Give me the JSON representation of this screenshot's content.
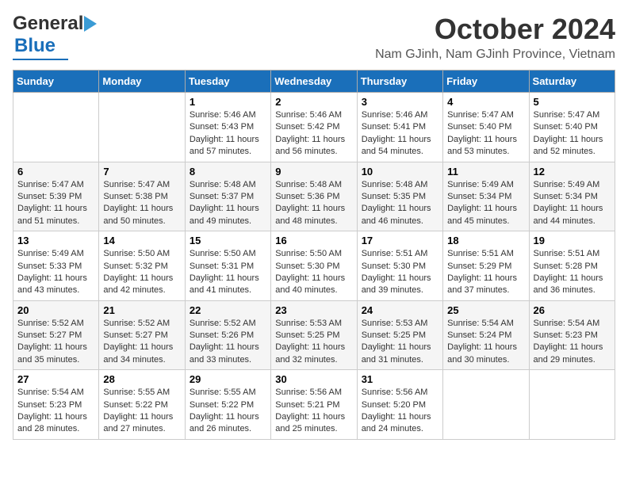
{
  "header": {
    "logo_line1": "General",
    "logo_line2": "Blue",
    "month": "October 2024",
    "location": "Nam GJinh, Nam GJinh Province, Vietnam"
  },
  "weekdays": [
    "Sunday",
    "Monday",
    "Tuesday",
    "Wednesday",
    "Thursday",
    "Friday",
    "Saturday"
  ],
  "weeks": [
    [
      {
        "day": "",
        "content": ""
      },
      {
        "day": "",
        "content": ""
      },
      {
        "day": "1",
        "content": "Sunrise: 5:46 AM\nSunset: 5:43 PM\nDaylight: 11 hours and 57 minutes."
      },
      {
        "day": "2",
        "content": "Sunrise: 5:46 AM\nSunset: 5:42 PM\nDaylight: 11 hours and 56 minutes."
      },
      {
        "day": "3",
        "content": "Sunrise: 5:46 AM\nSunset: 5:41 PM\nDaylight: 11 hours and 54 minutes."
      },
      {
        "day": "4",
        "content": "Sunrise: 5:47 AM\nSunset: 5:40 PM\nDaylight: 11 hours and 53 minutes."
      },
      {
        "day": "5",
        "content": "Sunrise: 5:47 AM\nSunset: 5:40 PM\nDaylight: 11 hours and 52 minutes."
      }
    ],
    [
      {
        "day": "6",
        "content": "Sunrise: 5:47 AM\nSunset: 5:39 PM\nDaylight: 11 hours and 51 minutes."
      },
      {
        "day": "7",
        "content": "Sunrise: 5:47 AM\nSunset: 5:38 PM\nDaylight: 11 hours and 50 minutes."
      },
      {
        "day": "8",
        "content": "Sunrise: 5:48 AM\nSunset: 5:37 PM\nDaylight: 11 hours and 49 minutes."
      },
      {
        "day": "9",
        "content": "Sunrise: 5:48 AM\nSunset: 5:36 PM\nDaylight: 11 hours and 48 minutes."
      },
      {
        "day": "10",
        "content": "Sunrise: 5:48 AM\nSunset: 5:35 PM\nDaylight: 11 hours and 46 minutes."
      },
      {
        "day": "11",
        "content": "Sunrise: 5:49 AM\nSunset: 5:34 PM\nDaylight: 11 hours and 45 minutes."
      },
      {
        "day": "12",
        "content": "Sunrise: 5:49 AM\nSunset: 5:34 PM\nDaylight: 11 hours and 44 minutes."
      }
    ],
    [
      {
        "day": "13",
        "content": "Sunrise: 5:49 AM\nSunset: 5:33 PM\nDaylight: 11 hours and 43 minutes."
      },
      {
        "day": "14",
        "content": "Sunrise: 5:50 AM\nSunset: 5:32 PM\nDaylight: 11 hours and 42 minutes."
      },
      {
        "day": "15",
        "content": "Sunrise: 5:50 AM\nSunset: 5:31 PM\nDaylight: 11 hours and 41 minutes."
      },
      {
        "day": "16",
        "content": "Sunrise: 5:50 AM\nSunset: 5:30 PM\nDaylight: 11 hours and 40 minutes."
      },
      {
        "day": "17",
        "content": "Sunrise: 5:51 AM\nSunset: 5:30 PM\nDaylight: 11 hours and 39 minutes."
      },
      {
        "day": "18",
        "content": "Sunrise: 5:51 AM\nSunset: 5:29 PM\nDaylight: 11 hours and 37 minutes."
      },
      {
        "day": "19",
        "content": "Sunrise: 5:51 AM\nSunset: 5:28 PM\nDaylight: 11 hours and 36 minutes."
      }
    ],
    [
      {
        "day": "20",
        "content": "Sunrise: 5:52 AM\nSunset: 5:27 PM\nDaylight: 11 hours and 35 minutes."
      },
      {
        "day": "21",
        "content": "Sunrise: 5:52 AM\nSunset: 5:27 PM\nDaylight: 11 hours and 34 minutes."
      },
      {
        "day": "22",
        "content": "Sunrise: 5:52 AM\nSunset: 5:26 PM\nDaylight: 11 hours and 33 minutes."
      },
      {
        "day": "23",
        "content": "Sunrise: 5:53 AM\nSunset: 5:25 PM\nDaylight: 11 hours and 32 minutes."
      },
      {
        "day": "24",
        "content": "Sunrise: 5:53 AM\nSunset: 5:25 PM\nDaylight: 11 hours and 31 minutes."
      },
      {
        "day": "25",
        "content": "Sunrise: 5:54 AM\nSunset: 5:24 PM\nDaylight: 11 hours and 30 minutes."
      },
      {
        "day": "26",
        "content": "Sunrise: 5:54 AM\nSunset: 5:23 PM\nDaylight: 11 hours and 29 minutes."
      }
    ],
    [
      {
        "day": "27",
        "content": "Sunrise: 5:54 AM\nSunset: 5:23 PM\nDaylight: 11 hours and 28 minutes."
      },
      {
        "day": "28",
        "content": "Sunrise: 5:55 AM\nSunset: 5:22 PM\nDaylight: 11 hours and 27 minutes."
      },
      {
        "day": "29",
        "content": "Sunrise: 5:55 AM\nSunset: 5:22 PM\nDaylight: 11 hours and 26 minutes."
      },
      {
        "day": "30",
        "content": "Sunrise: 5:56 AM\nSunset: 5:21 PM\nDaylight: 11 hours and 25 minutes."
      },
      {
        "day": "31",
        "content": "Sunrise: 5:56 AM\nSunset: 5:20 PM\nDaylight: 11 hours and 24 minutes."
      },
      {
        "day": "",
        "content": ""
      },
      {
        "day": "",
        "content": ""
      }
    ]
  ]
}
